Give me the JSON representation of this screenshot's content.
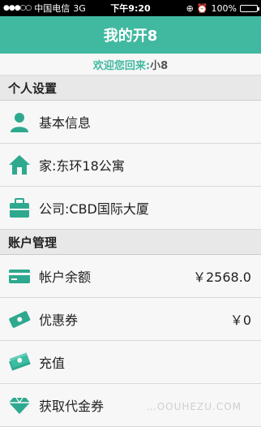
{
  "status_bar": {
    "signal": "●●●○○",
    "carrier": "中国电信",
    "network": "3G",
    "time": "下午9:20",
    "battery": "100%",
    "battery_level": 1.0
  },
  "nav": {
    "title": "我的开8"
  },
  "welcome": {
    "prefix": "欢迎您回来:",
    "name": "小8"
  },
  "sections": {
    "personal": "个人设置",
    "account": "账户管理"
  },
  "personal_items": [
    {
      "label": "基本信息",
      "icon": "person-icon"
    },
    {
      "label": "家:东环18公寓",
      "icon": "home-icon"
    },
    {
      "label": "公司:CBD国际大厦",
      "icon": "briefcase-icon"
    }
  ],
  "account_items": [
    {
      "label": "帐户余额",
      "value": "￥2568.0",
      "icon": "card-icon"
    },
    {
      "label": "优惠券",
      "value": "￥0",
      "icon": "ticket-icon"
    },
    {
      "label": "充值",
      "value": "",
      "icon": "cash-icon"
    },
    {
      "label": "获取代金券",
      "value": "",
      "icon": "diamond-icon"
    }
  ],
  "watermark": "…OOUHEZU.COM",
  "colors": {
    "accent": "#41b9a0",
    "icon": "#2ea98f"
  }
}
